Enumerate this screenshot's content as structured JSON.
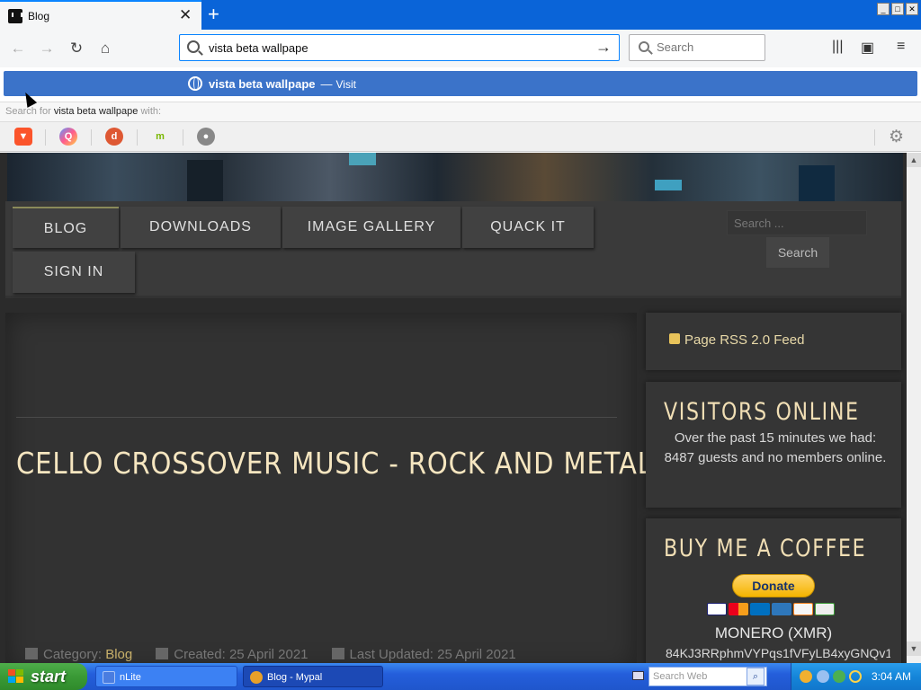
{
  "browser": {
    "tab_title": "Blog",
    "url_text": "vista beta wallpape",
    "search_placeholder": "Search",
    "suggestion": {
      "text": "vista beta wallpape",
      "dash": "—",
      "visit_label": "Visit"
    },
    "search_with": {
      "prefix": "Search for",
      "query": "vista beta wallpape",
      "suffix": "with:"
    },
    "search_engines": [
      "brave-icon",
      "qwant-icon",
      "duckduckgo-icon",
      "mojeek-icon",
      "searx-icon"
    ]
  },
  "site": {
    "menu": [
      "BLOG",
      "DOWNLOADS",
      "IMAGE GALLERY",
      "QUACK IT",
      "SIGN IN"
    ],
    "search_placeholder": "Search ...",
    "search_button": "Search",
    "article": {
      "title": "CELLO CROSSOVER MUSIC - ROCK AND METAL",
      "category_label": "Category:",
      "category_value": "Blog",
      "created": "Created: 25 April 2021",
      "updated": "Last Updated: 25 April 2021"
    },
    "sidebar": {
      "rss": "Page RSS 2.0 Feed",
      "visitors_heading": "VISITORS ONLINE",
      "visitors_text": "Over the past 15 minutes we had: 8487 guests and no members online.",
      "coffee_heading": "BUY ME A COFFEE",
      "donate_label": "Donate",
      "monero_label": "MONERO (XMR)",
      "monero_address": "84KJ3RRphmVYPqs1fVFyLB4xyGNQv1"
    }
  },
  "taskbar": {
    "start_label": "start",
    "tasks": [
      "nLite",
      "Blog - Mypal"
    ],
    "search_placeholder": "Search Web",
    "clock": "3:04 AM"
  },
  "colors": {
    "accent": "#0a84ff",
    "suggest_bg": "#3b73c9",
    "heading": "#f1dfb5",
    "page_bg": "#2b2b2b"
  }
}
